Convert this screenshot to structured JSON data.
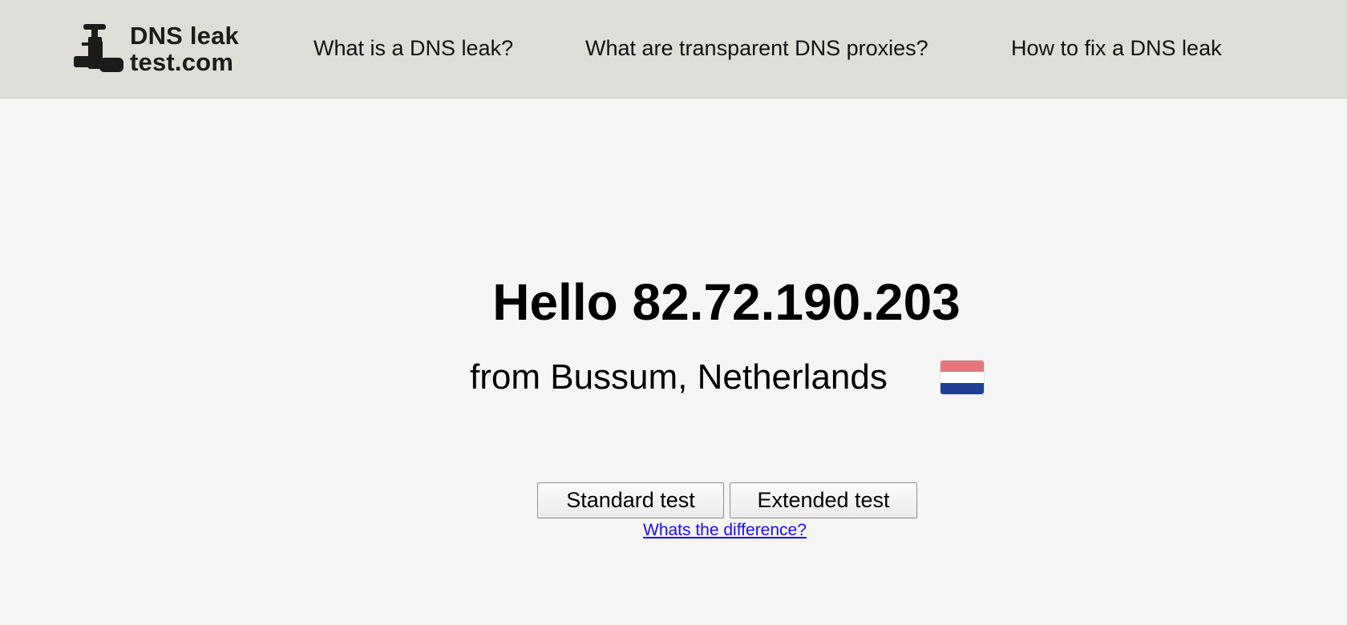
{
  "header": {
    "logo": {
      "line1": "DNS leak",
      "line2": "test.com",
      "icon": "faucet-icon"
    },
    "nav": [
      {
        "label": "What is a DNS leak?"
      },
      {
        "label": "What are transparent DNS proxies?"
      },
      {
        "label": "How to fix a DNS leak"
      }
    ]
  },
  "main": {
    "greeting": "Hello 82.72.190.203",
    "location": "from Bussum, Netherlands",
    "flag": {
      "icon": "netherlands-flag-icon",
      "colors": [
        "#e5767c",
        "#ffffff",
        "#1f3f94"
      ]
    },
    "buttons": {
      "standard": "Standard test",
      "extended": "Extended test"
    },
    "difference_link": "Whats the difference?"
  },
  "colors": {
    "header_bg": "#deddd8",
    "page_bg": "#f5f5f5",
    "link": "#1a0dff"
  }
}
